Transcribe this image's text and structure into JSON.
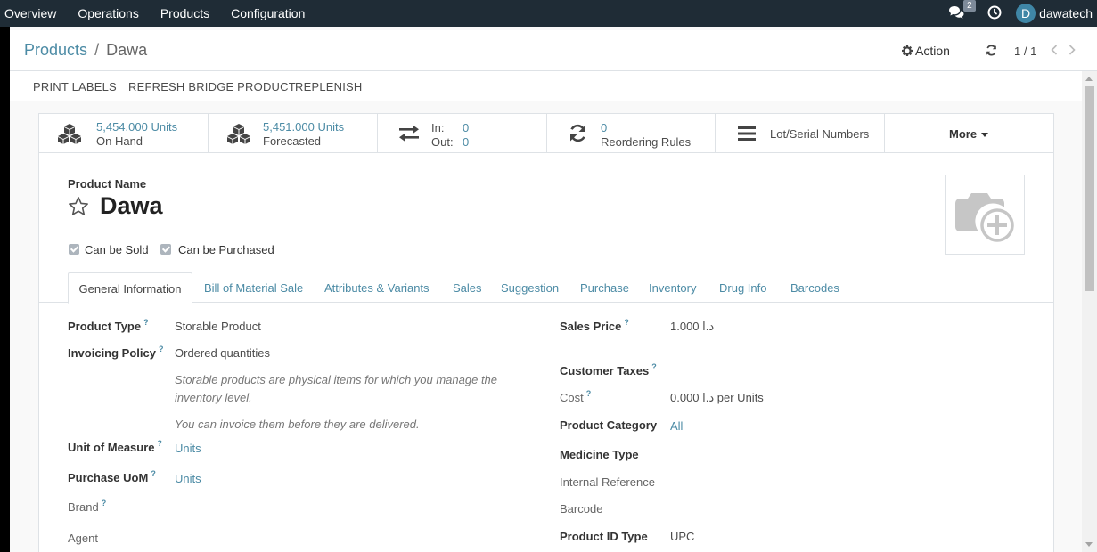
{
  "navbar": {
    "menu": [
      "Overview",
      "Operations",
      "Products",
      "Configuration"
    ],
    "chat_count": "2",
    "user_initial": "D",
    "username": "dawatech"
  },
  "breadcrumb": {
    "parent": "Products",
    "separator": "/",
    "current": "Dawa"
  },
  "control": {
    "action_label": "Action",
    "pager": "1 / 1"
  },
  "statusbar": {
    "buttons": [
      "PRINT LABELS",
      "REFRESH BRIDGE PRODUCT",
      "REPLENISH"
    ]
  },
  "smart_buttons": {
    "on_hand_value": "5,454.000 Units",
    "on_hand_label": "On Hand",
    "forecasted_value": "5,451.000 Units",
    "forecasted_label": "Forecasted",
    "in_label": "In:",
    "in_value": "0",
    "out_label": "Out:",
    "out_value": "0",
    "reorder_value": "0",
    "reorder_label": "Reordering Rules",
    "lots_label": "Lot/Serial Numbers",
    "more_label": "More"
  },
  "product": {
    "name_label": "Product Name",
    "name": "Dawa",
    "can_be_sold": "Can be Sold",
    "can_be_purchased": "Can be Purchased"
  },
  "tabs": [
    "General Information",
    "Bill of Material Sale",
    "Attributes & Variants",
    "Sales",
    "Suggestion",
    "Purchase",
    "Inventory",
    "Drug Info",
    "Barcodes"
  ],
  "left_fields": {
    "product_type_label": "Product Type",
    "product_type": "Storable Product",
    "invoicing_policy_label": "Invoicing Policy",
    "invoicing_policy": "Ordered quantities",
    "help_storable": "Storable products are physical items for which you manage the inventory level.",
    "help_invoice": "You can invoice them before they are delivered.",
    "uom_label": "Unit of Measure",
    "uom": "Units",
    "purchase_uom_label": "Purchase UoM",
    "purchase_uom": "Units",
    "brand_label": "Brand",
    "agent_label": "Agent"
  },
  "right_fields": {
    "sales_price_label": "Sales Price",
    "sales_price": "1.000 د.ا",
    "customer_taxes_label": "Customer Taxes",
    "cost_label": "Cost",
    "cost": "0.000 د.ا per Units",
    "category_label": "Product Category",
    "category": "All",
    "medicine_type_label": "Medicine Type",
    "internal_ref_label": "Internal Reference",
    "barcode_label": "Barcode",
    "product_id_type_label": "Product ID Type",
    "product_id_type": "UPC"
  },
  "help_mark": "?",
  "colors": {
    "navbar": "#1f2c36",
    "link": "#4c8ba5",
    "avatar": "#3f86a6"
  }
}
